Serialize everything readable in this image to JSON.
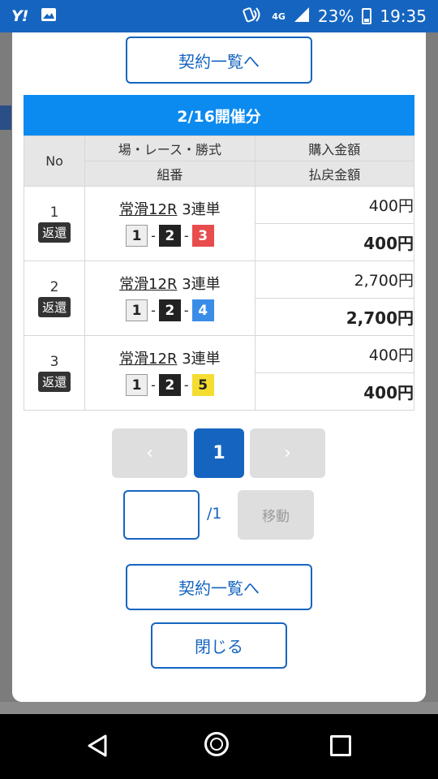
{
  "status_bar": {
    "logo": "Y!",
    "network": "4G",
    "battery": "23%",
    "time": "19:35"
  },
  "modal": {
    "top_button_label": "契約一覧へ",
    "table_title": "2/16開催分",
    "headers": {
      "no": "No",
      "race_info": "場・レース・勝式",
      "combination": "組番",
      "purchase_amount": "購入金額",
      "payout_amount": "払戻金額"
    },
    "rows": [
      {
        "no": "1",
        "badge": "返還",
        "venue": "常滑12R",
        "bet_type": "3連単",
        "combo": [
          "1",
          "2",
          "3"
        ],
        "purchase": "400円",
        "payout": "400円"
      },
      {
        "no": "2",
        "badge": "返還",
        "venue": "常滑12R",
        "bet_type": "3連単",
        "combo": [
          "1",
          "2",
          "4"
        ],
        "purchase": "2,700円",
        "payout": "2,700円"
      },
      {
        "no": "3",
        "badge": "返還",
        "venue": "常滑12R",
        "bet_type": "3連単",
        "combo": [
          "1",
          "2",
          "5"
        ],
        "purchase": "400円",
        "payout": "400円"
      }
    ],
    "pager": {
      "prev": "‹",
      "current": "1",
      "next": "›",
      "total": "/1",
      "move_label": "移動",
      "input_value": ""
    },
    "bottom_button_label": "契約一覧へ",
    "close_button_label": "閉じる"
  },
  "colors": {
    "primary": "#1565c0",
    "header_blue": "#0b8af0",
    "boat_3": "#e84c4c",
    "boat_4": "#3a8de6",
    "boat_5": "#f5dc30"
  }
}
